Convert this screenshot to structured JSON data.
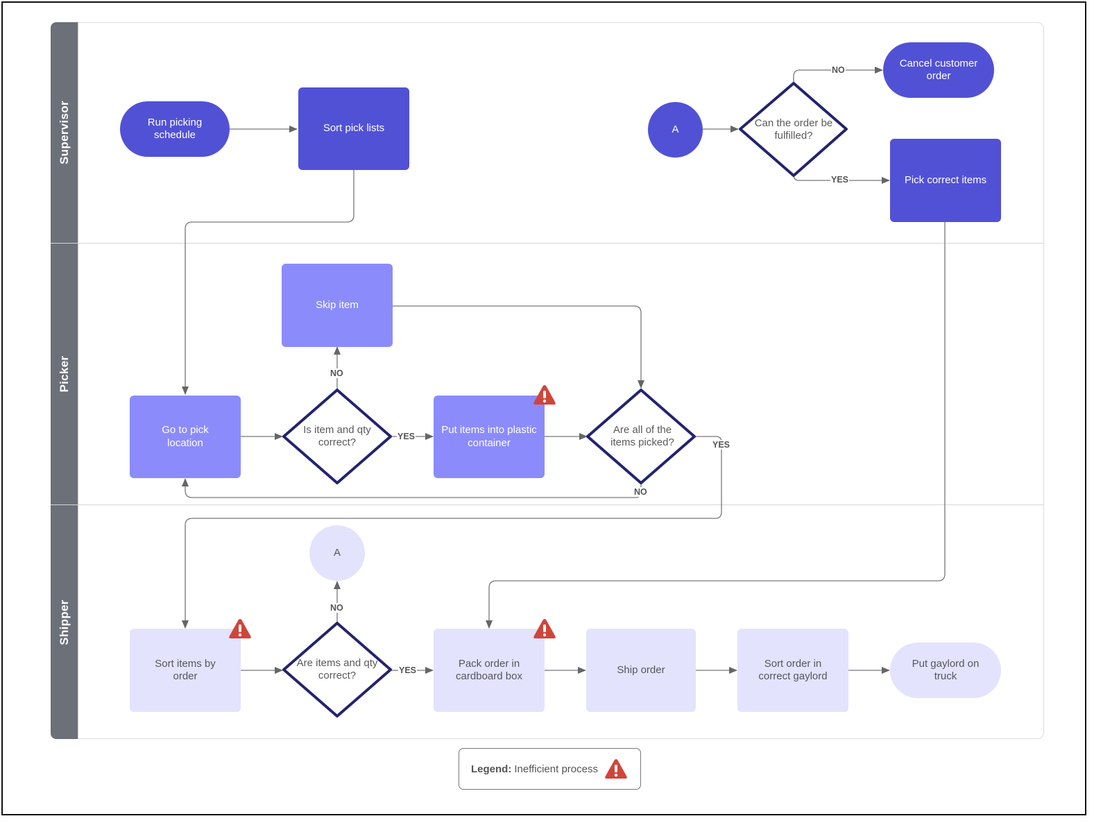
{
  "lanes": [
    {
      "id": "supervisor",
      "label": "Supervisor"
    },
    {
      "id": "picker",
      "label": "Picker"
    },
    {
      "id": "shipper",
      "label": "Shipper"
    }
  ],
  "nodes": {
    "run_picking_schedule": "Run picking schedule",
    "sort_pick_lists": "Sort pick lists",
    "connector_a_supervisor": "A",
    "can_order_be_fulfilled": "Can the order be fulfilled?",
    "cancel_customer_order": "Cancel customer order",
    "pick_correct_items": "Pick correct items",
    "skip_item": "Skip item",
    "go_to_pick_location": "Go to pick location",
    "is_item_qty_correct": "Is item and qty correct?",
    "put_items_plastic_container": "Put items into plastic container",
    "are_all_items_picked": "Are all of the items picked?",
    "connector_a_shipper": "A",
    "sort_items_by_order": "Sort items by order",
    "are_items_qty_correct": "Are items and qty correct?",
    "pack_order_cardboard_box": "Pack order in cardboard box",
    "ship_order": "Ship order",
    "sort_order_correct_gaylord": "Sort order in correct gaylord",
    "put_gaylord_on_truck": "Put gaylord on truck"
  },
  "edge_labels": {
    "fulfilled_no": "NO",
    "fulfilled_yes": "YES",
    "item_qty_no": "NO",
    "item_qty_yes": "YES",
    "all_picked_yes": "YES",
    "all_picked_no": "NO",
    "items_qty_no": "NO",
    "items_qty_yes": "YES"
  },
  "legend": {
    "title": "Legend:",
    "text": "Inefficient process",
    "icon": "warning-triangle-icon"
  },
  "inefficient_steps": [
    "Put items into plastic container",
    "Sort items by order",
    "Pack order in cardboard box"
  ],
  "colors": {
    "dark_node": "#5151d6",
    "mid_node": "#8b8bfc",
    "light_node": "#e3e3fd",
    "diamond_stroke": "#23236e",
    "warning": "#d0453a",
    "lane_header": "#6b7079",
    "connector": "#666666"
  }
}
